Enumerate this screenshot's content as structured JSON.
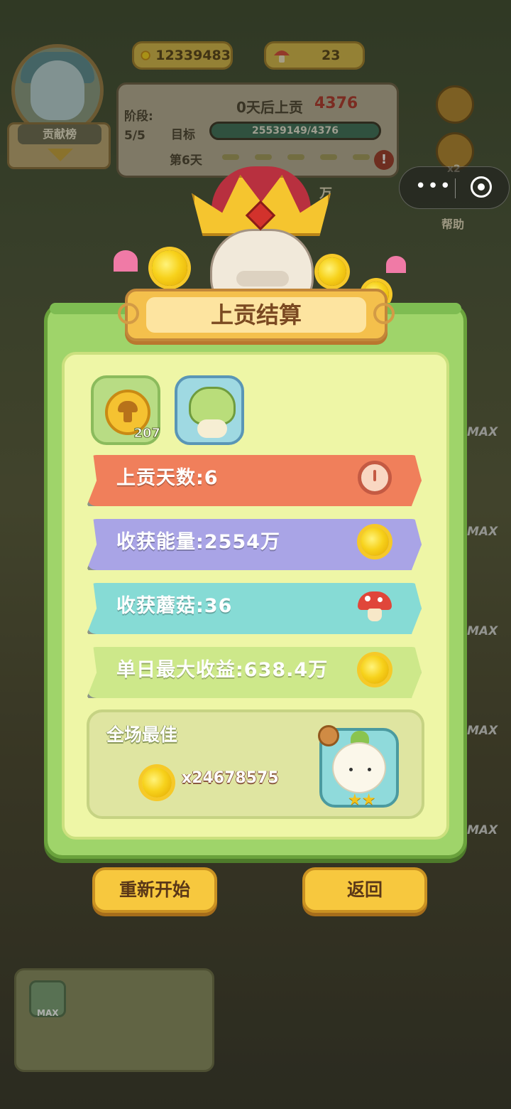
{
  "hud": {
    "coins": "12339483",
    "mushrooms": "23",
    "rank_label": "贡献榜",
    "stage_label": "阶段:",
    "stage_value": "5/5",
    "tribute_countdown": "0天后上贡",
    "tribute_amount": "4376",
    "target_label": "目标",
    "target_progress": "25539149/4376",
    "day_label": "第6天",
    "speed_label": "x2",
    "help_label": "帮助",
    "partial_unit": "万"
  },
  "dialog": {
    "title": "上贡结算",
    "reward_coin_count": "207",
    "stats": [
      {
        "label": "上贡天数:6",
        "icon": "stopwatch-icon",
        "color": "#f07f5b"
      },
      {
        "label": "收获能量:2554万",
        "icon": "sun-icon",
        "color": "#a9a4e6"
      },
      {
        "label": "收获蘑菇:36",
        "icon": "mushroom-icon",
        "color": "#86dbd5"
      },
      {
        "label": "单日最大收益:638.4万",
        "icon": "sun-icon",
        "color": "#cde88a"
      }
    ],
    "best_title": "全场最佳",
    "best_value": "x24678575",
    "best_stars": "★★"
  },
  "buttons": {
    "restart": "重新开始",
    "back": "返回"
  },
  "background": {
    "max_tag": "MAX"
  }
}
